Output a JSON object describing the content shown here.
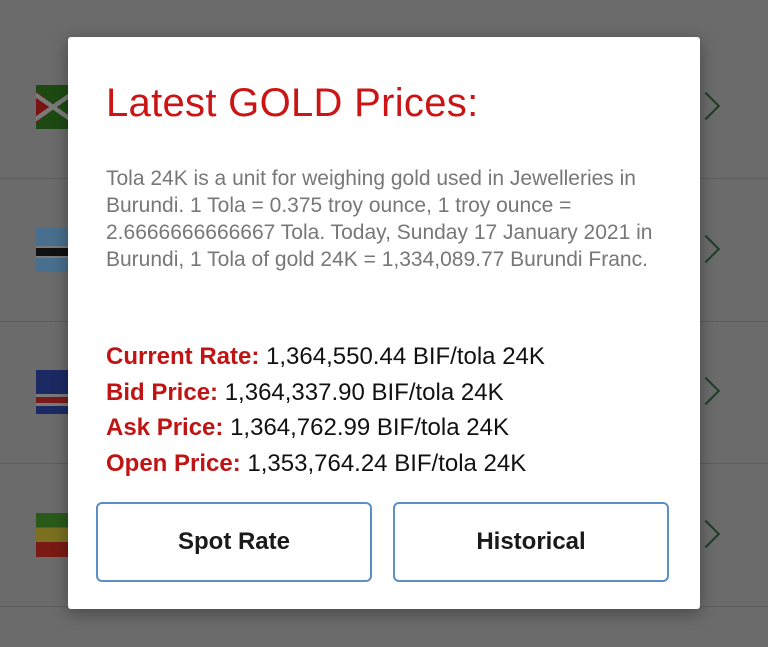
{
  "dialog": {
    "title": "Latest GOLD Prices:",
    "description": "Tola 24K is a unit for weighing gold used in Jewelleries in Burundi. 1 Tola = 0.375 troy ounce, 1 troy ounce = 2.6666666666667 Tola. Today, Sunday 17 January 2021 in Burundi, 1 Tola of gold 24K = 1,334,089.77 Burundi Franc.",
    "rates": [
      {
        "label": "Current Rate:",
        "value": "1,364,550.44 BIF/tola 24K"
      },
      {
        "label": "Bid Price:",
        "value": "1,364,337.90 BIF/tola 24K"
      },
      {
        "label": "Ask Price:",
        "value": "1,364,762.99 BIF/tola 24K"
      },
      {
        "label": "Open Price:",
        "value": "1,353,764.24 BIF/tola 24K"
      }
    ],
    "buttons": {
      "spot_rate": "Spot Rate",
      "historical": "Historical"
    }
  },
  "background_list": {
    "flags": [
      "burundi-flag-icon",
      "botswana-flag-icon",
      "cape-verde-flag-icon",
      "ethiopia-flag-icon"
    ],
    "chevron_icon": "chevron-right-icon"
  },
  "colors": {
    "title": "#cc1414",
    "rate_label": "#c01414",
    "button_border": "#5b8fc6",
    "overlay": "#6b6b6b"
  }
}
